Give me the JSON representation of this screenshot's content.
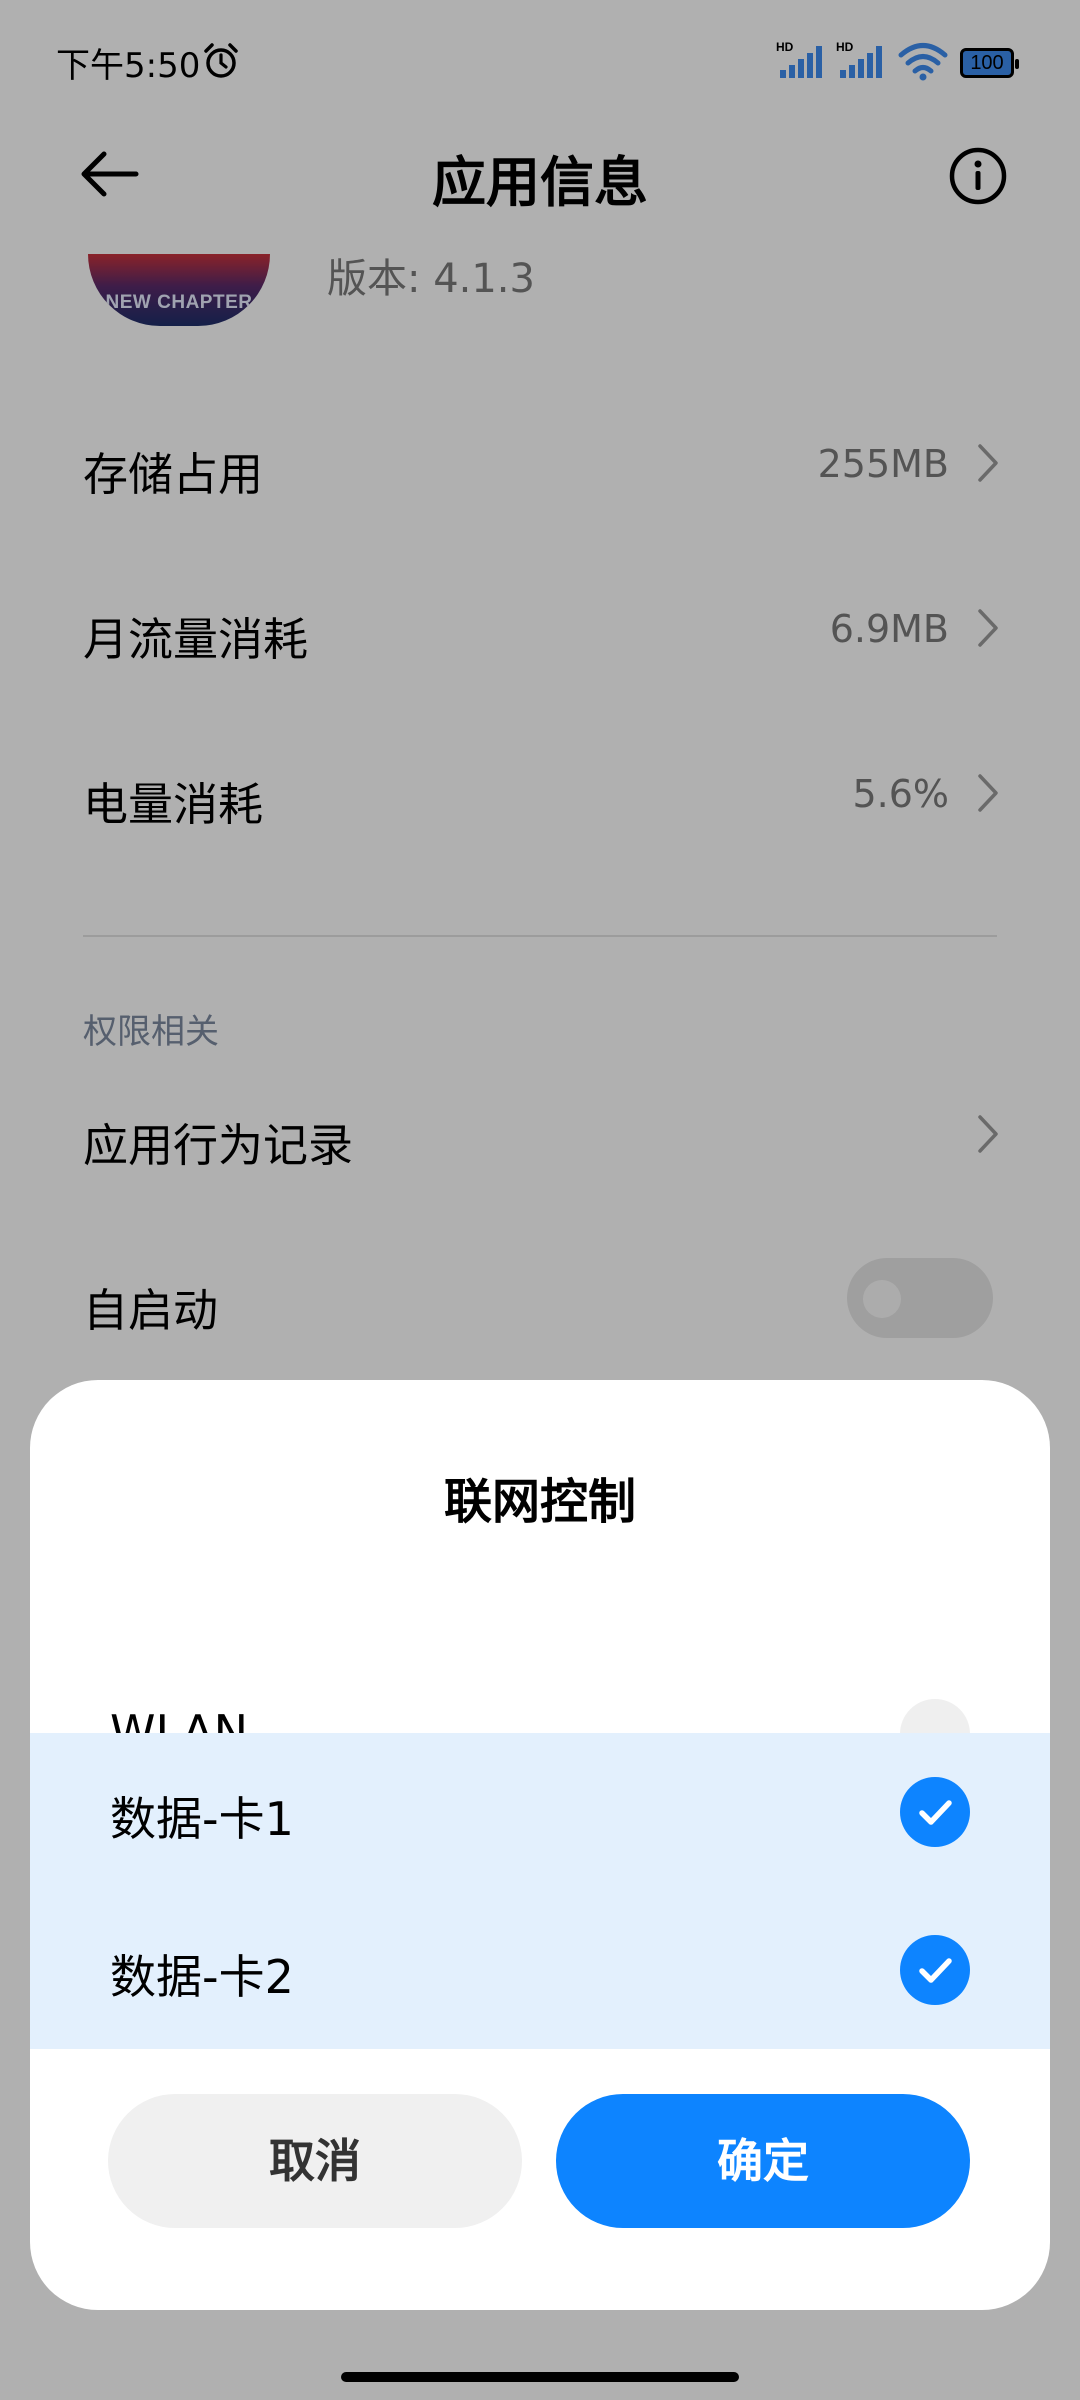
{
  "status_bar": {
    "time": "下午5:50",
    "sim1_label": "HD",
    "sim2_label": "HD",
    "battery": "100"
  },
  "app_bar": {
    "title": "应用信息"
  },
  "app_header": {
    "icon_text": "NEW CHAPTER",
    "version": "版本: 4.1.3"
  },
  "rows": [
    {
      "label": "存储占用",
      "value": "255MB"
    },
    {
      "label": "月流量消耗",
      "value": "6.9MB"
    },
    {
      "label": "电量消耗",
      "value": "5.6%"
    }
  ],
  "permissions": {
    "section_title": "权限相关",
    "behavior_log": "应用行为记录",
    "autostart": "自启动",
    "autostart_on": false
  },
  "dialog": {
    "title": "联网控制",
    "options": [
      {
        "label": "WLAN",
        "checked": false
      },
      {
        "label": "数据-卡1",
        "checked": true
      },
      {
        "label": "数据-卡2",
        "checked": true
      }
    ],
    "cancel_label": "取消",
    "ok_label": "确定"
  },
  "colors": {
    "accent": "#0d84ff",
    "selected_row": "#e3f0fd",
    "scrim": "rgba(0,0,0,0.31)"
  }
}
